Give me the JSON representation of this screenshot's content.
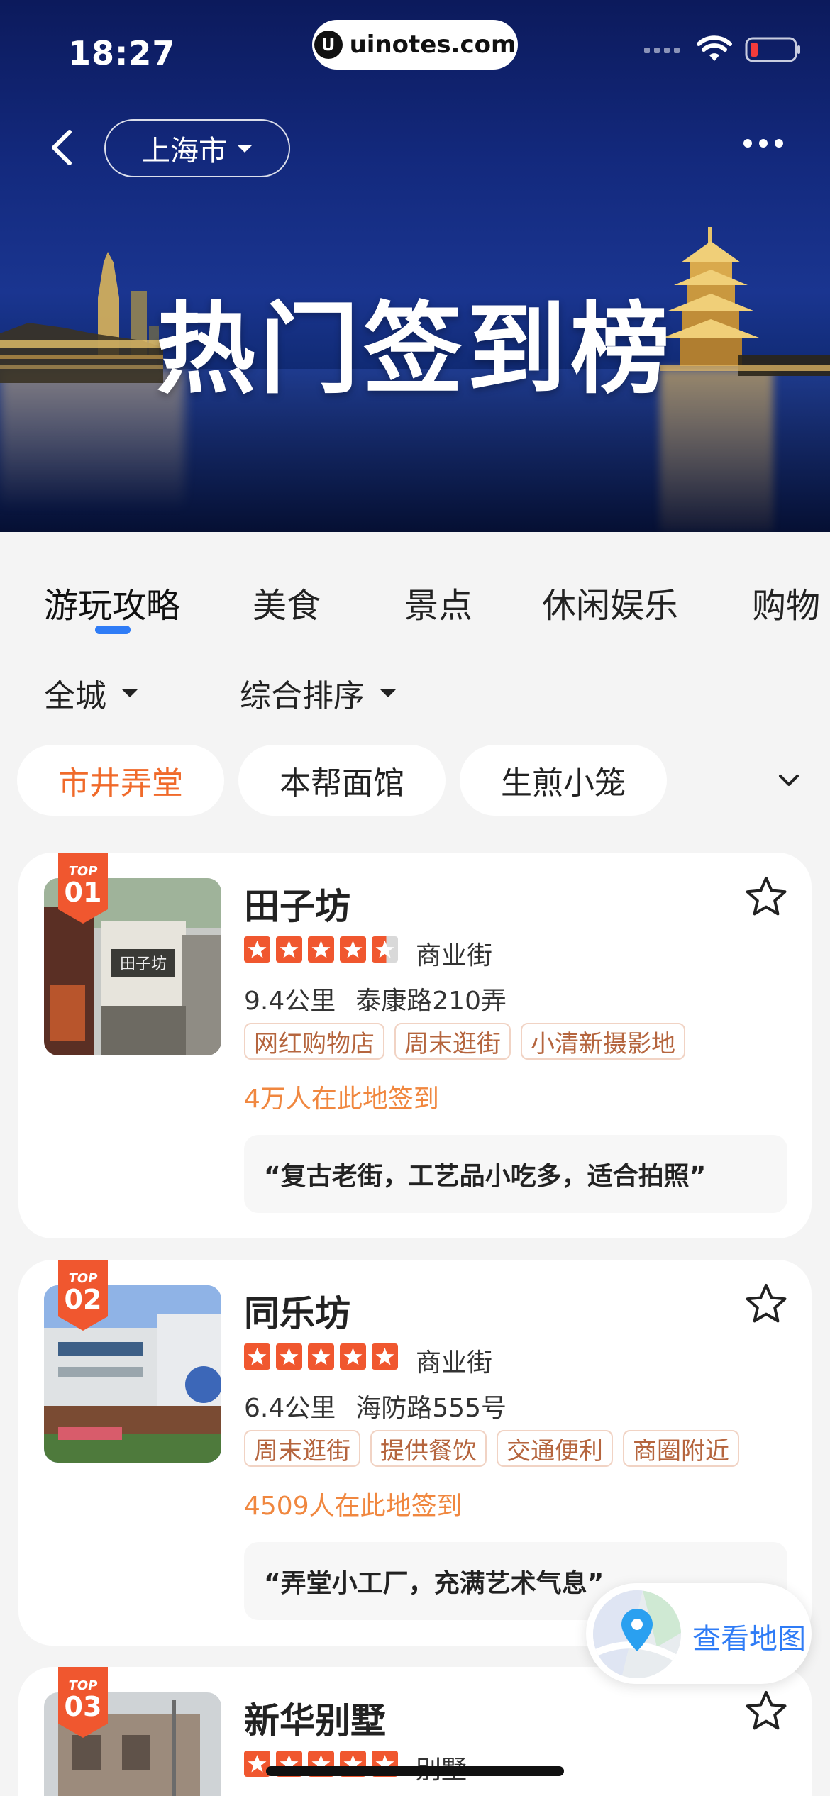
{
  "status_bar": {
    "time": "18:27"
  },
  "watermark": {
    "logo": "U",
    "text": "uinotes.com"
  },
  "header": {
    "city": "上海市",
    "hero_title": "热门签到榜"
  },
  "category_tabs": [
    {
      "label": "游玩攻略",
      "active": true
    },
    {
      "label": "美食",
      "active": false
    },
    {
      "label": "景点",
      "active": false
    },
    {
      "label": "休闲娱乐",
      "active": false
    },
    {
      "label": "购物",
      "active": false
    }
  ],
  "filters": {
    "area": "全城",
    "sort": "综合排序"
  },
  "chips": [
    {
      "label": "市井弄堂",
      "active": true
    },
    {
      "label": "本帮面馆",
      "active": false
    },
    {
      "label": "生煎小笼",
      "active": false
    }
  ],
  "places": [
    {
      "rank_top": "TOP",
      "rank": "01",
      "name": "田子坊",
      "rating": 4.5,
      "category": "商业街",
      "distance": "9.4公里",
      "address": "泰康路210弄",
      "tags": [
        "网红购物店",
        "周末逛街",
        "小清新摄影地"
      ],
      "checkins": "4万人在此地签到",
      "quote": "“复古老街，工艺品小吃多，适合拍照”"
    },
    {
      "rank_top": "TOP",
      "rank": "02",
      "name": "同乐坊",
      "rating": 5,
      "category": "商业街",
      "distance": "6.4公里",
      "address": "海防路555号",
      "tags": [
        "周末逛街",
        "提供餐饮",
        "交通便利",
        "商圈附近"
      ],
      "checkins": "4509人在此地签到",
      "quote": "“弄堂小工厂，充满艺术气息”"
    },
    {
      "rank_top": "TOP",
      "rank": "03",
      "name": "新华别墅",
      "rating": 5,
      "category": "别墅"
    }
  ],
  "map_button": {
    "label": "查看地图"
  },
  "colors": {
    "accent_orange": "#f0572f",
    "tag_text": "#b5653e",
    "checkin_orange": "#f0873f",
    "link_blue": "#2f7cf6"
  }
}
